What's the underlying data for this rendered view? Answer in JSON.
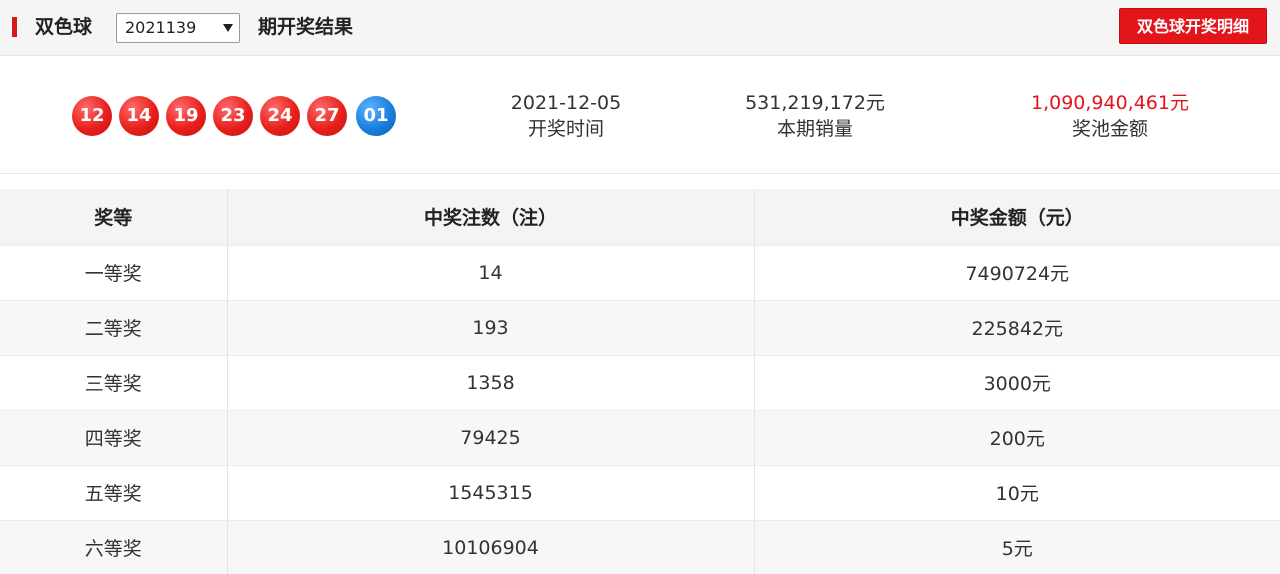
{
  "header": {
    "game_title": "双色球",
    "issue": "2021139",
    "suffix": "期开奖结果",
    "detail_button": "双色球开奖明细"
  },
  "draw": {
    "red_balls": [
      "12",
      "14",
      "19",
      "23",
      "24",
      "27"
    ],
    "blue_ball": "01",
    "date": "2021-12-05",
    "date_label": "开奖时间",
    "sales": "531,219,172元",
    "sales_label": "本期销量",
    "pool": "1,090,940,461元",
    "pool_label": "奖池金额"
  },
  "colors": {
    "red_ball": "#e8201c",
    "blue_ball": "#1a7fe0",
    "accent": "#e3141a"
  },
  "table": {
    "headers": [
      "奖等",
      "中奖注数（注）",
      "中奖金额（元）"
    ],
    "rows": [
      [
        "一等奖",
        "14",
        "7490724元"
      ],
      [
        "二等奖",
        "193",
        "225842元"
      ],
      [
        "三等奖",
        "1358",
        "3000元"
      ],
      [
        "四等奖",
        "79425",
        "200元"
      ],
      [
        "五等奖",
        "1545315",
        "10元"
      ],
      [
        "六等奖",
        "10106904",
        "5元"
      ]
    ]
  }
}
